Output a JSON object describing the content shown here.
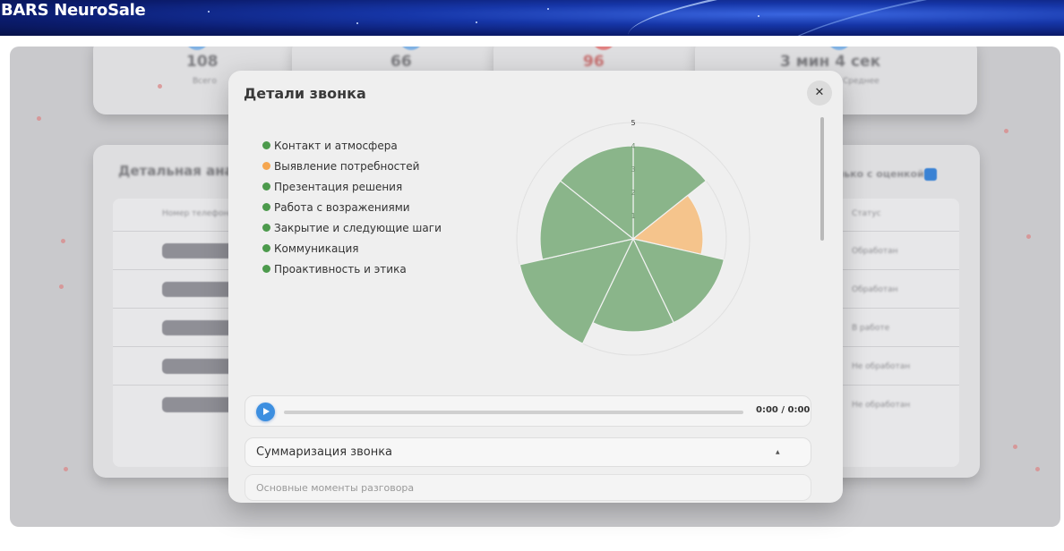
{
  "app": {
    "brand": "BARS NeuroSale"
  },
  "background": {
    "stats": [
      "108",
      "66",
      "96",
      "3 мин 4 сек"
    ],
    "stat_captions": [
      "Всего",
      "",
      "",
      "Среднее"
    ],
    "section_title": "Детальная аналитика",
    "table_header_phone": "Номер телефона",
    "table_header_status": "Статус",
    "filter_label": "Только с оценкой",
    "status_values": [
      "Обработан",
      "Обработан",
      "В работе",
      "Не обработан",
      "Не обработан"
    ]
  },
  "modal": {
    "title": "Детали звонка",
    "close_label": "✕",
    "player": {
      "time": "0:00 / 0:00"
    },
    "summary_title": "Суммаризация звонка",
    "summary_arrow": "▲",
    "next_section_title": "Основные моменты разговора"
  },
  "colors": {
    "good": "#4c9a4c",
    "warning": "#f5a64f",
    "good_fill": "#8ab58a",
    "warn_fill": "#f5c48c"
  },
  "chart_data": {
    "type": "polar-area",
    "scale_max": 5,
    "ticks": [
      "1",
      "2",
      "3",
      "4",
      "5"
    ],
    "categories": [
      "Контакт и атмосфера",
      "Выявление потребностей",
      "Презентация решения",
      "Работа с возражениями",
      "Закрытие и следующие шаги",
      "Коммуникация",
      "Проактивность и этика"
    ],
    "values": [
      4,
      3,
      4,
      4,
      5,
      4,
      4
    ],
    "statuses": [
      "good",
      "warning",
      "good",
      "good",
      "good",
      "good",
      "good"
    ],
    "legend_position": "left"
  }
}
